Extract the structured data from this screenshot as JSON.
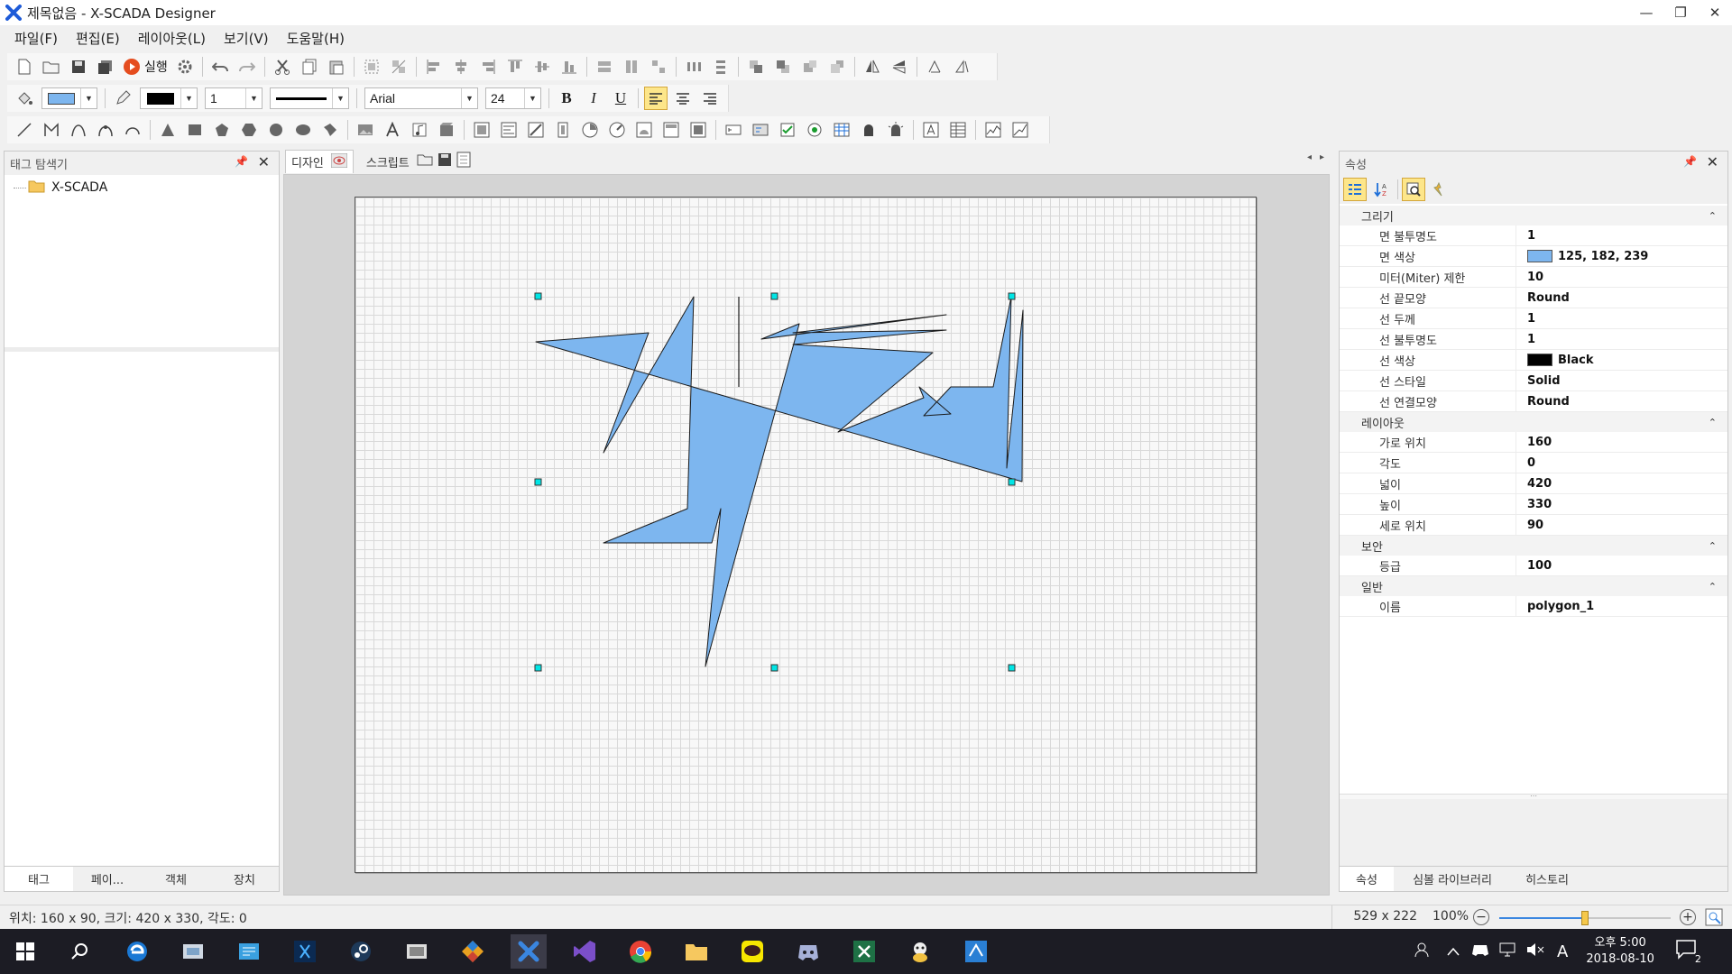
{
  "app": {
    "title": "제목없음 - X-SCADA Designer"
  },
  "window_controls": {
    "minimize": "—",
    "restore": "❐",
    "close": "✕"
  },
  "menu": [
    "파일(F)",
    "편집(E)",
    "레이아웃(L)",
    "보기(V)",
    "도움말(H)"
  ],
  "toolbar": {
    "run_label": "실행",
    "line_width": "1",
    "font_name": "Arial",
    "font_size": "24",
    "bold": "B",
    "italic": "I",
    "underline": "U",
    "fill_color": "#7db6ef"
  },
  "tag_explorer": {
    "title": "태그 탐색기",
    "root": "X-SCADA",
    "tabs": [
      "태그",
      "페이...",
      "객체",
      "장치"
    ]
  },
  "document_tabs": {
    "design": "디자인",
    "script": "스크립트"
  },
  "canvas": {
    "polygon_fill": "#7db6ef",
    "handle_color": "#00e5e5"
  },
  "properties": {
    "title": "속성",
    "categories": [
      {
        "name": "그리기",
        "rows": [
          {
            "key": "면 불투명도",
            "value": "1"
          },
          {
            "key": "면 색상",
            "value": "125, 182, 239",
            "swatch": "#7db6ef"
          },
          {
            "key": "미터(Miter) 제한",
            "value": "10"
          },
          {
            "key": "선 끝모양",
            "value": "Round"
          },
          {
            "key": "선 두께",
            "value": "1"
          },
          {
            "key": "선 불투명도",
            "value": "1"
          },
          {
            "key": "선 색상",
            "value": "Black",
            "swatch": "#000000"
          },
          {
            "key": "선 스타일",
            "value": "Solid"
          },
          {
            "key": "선 연결모양",
            "value": "Round"
          }
        ]
      },
      {
        "name": "레이아웃",
        "rows": [
          {
            "key": "가로 위치",
            "value": "160"
          },
          {
            "key": "각도",
            "value": "0"
          },
          {
            "key": "넓이",
            "value": "420"
          },
          {
            "key": "높이",
            "value": "330"
          },
          {
            "key": "세로 위치",
            "value": "90"
          }
        ]
      },
      {
        "name": "보안",
        "rows": [
          {
            "key": "등급",
            "value": "100"
          }
        ]
      },
      {
        "name": "일반",
        "rows": [
          {
            "key": "이름",
            "value": "polygon_1"
          }
        ]
      }
    ],
    "tabs": [
      "속성",
      "심볼 라이브러리",
      "히스토리"
    ]
  },
  "status": {
    "info": "위치: 160 x 90, 크기: 420 x 330, 각도: 0",
    "size": "529 x 222",
    "zoom": "100%",
    "zoom_fraction": 0.5
  },
  "tray": {
    "ime": "A",
    "time": "오후 5:00",
    "date": "2018-08-10",
    "notifications": "2"
  }
}
